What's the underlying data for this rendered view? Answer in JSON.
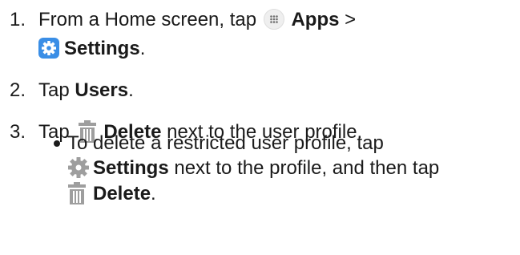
{
  "steps": [
    {
      "number": "1.",
      "line1_text": "From a Home screen, tap",
      "apps_label": "Apps",
      "apps_suffix": " >",
      "settings_label": "Settings",
      "line2_suffix": "."
    },
    {
      "number": "2.",
      "prefix": "Tap ",
      "users_label": "Users",
      "suffix": "."
    },
    {
      "number": "3.",
      "prefix": "Tap",
      "delete_label": "Delete",
      "suffix": " next to the user profile."
    }
  ],
  "sub_bullet": {
    "line1_text": "To delete a restricted user profile, tap",
    "settings_label": "Settings",
    "line2_suffix": " next to the profile, and then tap",
    "delete_label": "Delete",
    "line3_suffix": "."
  },
  "icons": {
    "apps": "apps-grid-icon",
    "settings": "settings-gear-blue-icon",
    "delete": "trash-icon",
    "settings_gray": "gear-icon"
  },
  "colors": {
    "settings_blue": "#3a8ee6",
    "icon_gray": "#9e9e9e",
    "text": "#1a1a1a"
  }
}
